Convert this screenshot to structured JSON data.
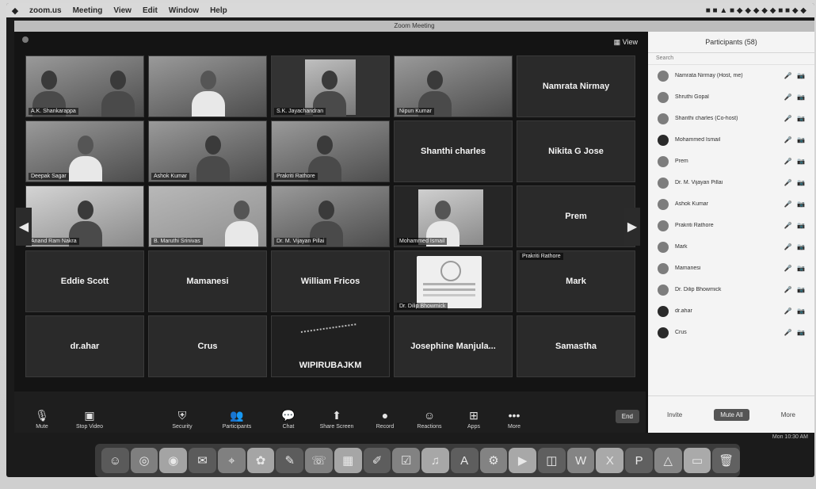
{
  "menubar": {
    "items": [
      "zoom.us",
      "Meeting",
      "View",
      "Edit",
      "Window",
      "Help"
    ],
    "status_right": "■ ■ ▲ ■  ◆ ◆ ◆ ◆ ◆ ■ ■ ◆ ◆"
  },
  "zoom": {
    "window_title": "Zoom Meeting",
    "view_label": "▦ View",
    "tiles": [
      {
        "name": "A.K. Shankarappa",
        "type": "camera"
      },
      {
        "name": "",
        "type": "camera"
      },
      {
        "name": "S.K. Jayachandran",
        "type": "camera"
      },
      {
        "name": "Nipun Kumar",
        "type": "camera"
      },
      {
        "name": "Namrata Nirmay",
        "type": "name"
      },
      {
        "name": "Deepak Sagar",
        "type": "camera"
      },
      {
        "name": "Ashok Kumar",
        "type": "camera"
      },
      {
        "name": "Prakriti Rathore",
        "type": "camera"
      },
      {
        "name": "Shanthi charles",
        "type": "name"
      },
      {
        "name": "Nikita G Jose",
        "type": "name"
      },
      {
        "name": "Anand Ram Nakra",
        "type": "camera"
      },
      {
        "name": "B. Maruthi Srinivas",
        "type": "camera"
      },
      {
        "name": "Dr. M. Vijayan Pillai",
        "type": "camera"
      },
      {
        "name": "Mohammed Ismail",
        "type": "camera"
      },
      {
        "name": "Prem",
        "type": "name"
      },
      {
        "name": "Eddie Scott",
        "type": "name"
      },
      {
        "name": "Mamanesi",
        "type": "name"
      },
      {
        "name": "William Fricos",
        "type": "name"
      },
      {
        "name": "Dr. Dilip Bhowmick",
        "type": "logo"
      },
      {
        "name": "Mark",
        "type": "name"
      },
      {
        "name": "dr.ahar",
        "type": "name"
      },
      {
        "name": "Crus",
        "type": "name"
      },
      {
        "name": "WIPIRUBAJKM",
        "type": "sketch"
      },
      {
        "name": "Josephine Manjula...",
        "type": "name"
      },
      {
        "name": "Samastha",
        "type": "name"
      }
    ],
    "tile_badge": "Prakriti Rathore",
    "arrow_left": "◀",
    "arrow_right": "▶",
    "toolbar": {
      "mute": "Mute",
      "video": "Stop Video",
      "security": "Security",
      "participants": "Participants",
      "chat": "Chat",
      "share": "Share Screen",
      "record": "Record",
      "reactions": "Reactions",
      "apps": "Apps",
      "more": "More",
      "end": "End"
    },
    "panel": {
      "title": "Participants (58)",
      "search_placeholder": "Search",
      "participants": [
        "Namrata Nirmay (Host, me)",
        "Shruthi Gopal",
        "Shanthi charles (Co-host)",
        "Mohammed Ismail",
        "Prem",
        "Dr. M. Vijayan Pillai",
        "Ashok Kumar",
        "Prakriti Rathore",
        "Mark",
        "Mamanesi",
        "Dr. Dilip Bhowmick",
        "dr.ahar",
        "Crus"
      ],
      "row_status": "🎤 📷",
      "foot": {
        "invite": "Invite",
        "mute_all": "Mute All",
        "more": "More"
      }
    },
    "status_time": "Mon 10:30 AM"
  },
  "dock": {
    "icons": [
      "finder-icon",
      "safari-icon",
      "chrome-icon",
      "mail-icon",
      "maps-icon",
      "photos-icon",
      "messages-icon",
      "facetime-icon",
      "calendar-icon",
      "notes-icon",
      "reminders-icon",
      "music-icon",
      "appstore-icon",
      "settings-icon",
      "zoom-icon",
      "preview-icon",
      "word-icon",
      "excel-icon",
      "powerpoint-icon",
      "vlc-icon",
      "folder-icon",
      "trash-icon"
    ],
    "glyphs": [
      "☺",
      "◎",
      "◉",
      "✉",
      "⌖",
      "✿",
      "✎",
      "☏",
      "▦",
      "✐",
      "☑",
      "♫",
      "A",
      "⚙",
      "▶",
      "◫",
      "W",
      "X",
      "P",
      "△",
      "▭",
      "🗑"
    ]
  }
}
